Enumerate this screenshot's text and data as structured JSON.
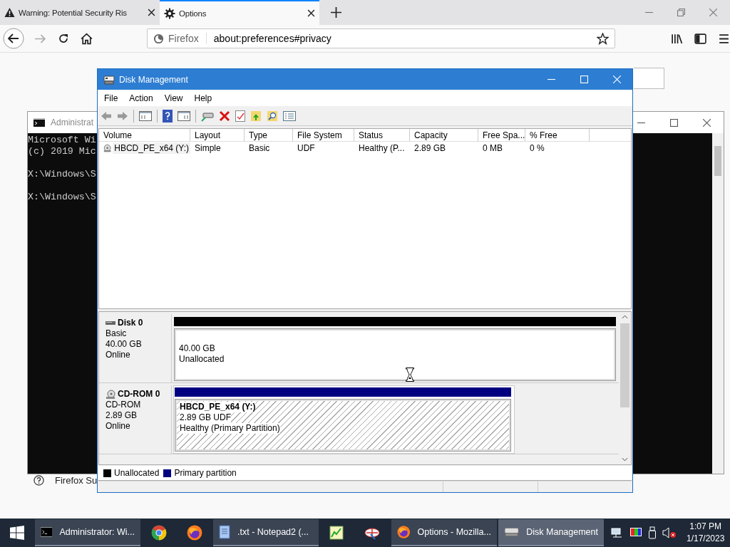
{
  "browser": {
    "tabs": [
      {
        "title": "Warning: Potential Security Ris",
        "kind": "warning",
        "selected": false
      },
      {
        "title": "Options",
        "kind": "settings",
        "selected": true
      }
    ],
    "address": {
      "identity": "Firefox",
      "url": "about:preferences#privacy"
    }
  },
  "page": {
    "support_link": "Firefox Su"
  },
  "console": {
    "title": "Administrat",
    "blocks": [
      [
        "Microsoft Wi",
        "(c) 2019 Mic"
      ],
      [
        "X:\\Windows\\S"
      ],
      [
        "X:\\Windows\\S"
      ]
    ]
  },
  "disk_management": {
    "title": "Disk Management",
    "menu": [
      "File",
      "Action",
      "View",
      "Help"
    ],
    "columns": [
      "Volume",
      "Layout",
      "Type",
      "File System",
      "Status",
      "Capacity",
      "Free Spa...",
      "% Free"
    ],
    "volumes": [
      {
        "cells": [
          "HBCD_PE_x64 (Y:)",
          "Simple",
          "Basic",
          "UDF",
          "Healthy (P...",
          "2.89 GB",
          "0 MB",
          "0 %"
        ],
        "selected": true
      }
    ],
    "disks": [
      {
        "kind": "disk",
        "name": "Disk 0",
        "type": "Basic",
        "size": "40.00 GB",
        "status": "Online",
        "partitions": [
          {
            "kind": "unallocated",
            "color": "#000000",
            "lines": [
              "40.00 GB",
              "Unallocated"
            ]
          }
        ]
      },
      {
        "kind": "cdrom",
        "name": "CD-ROM 0",
        "type": "CD-ROM",
        "size": "2.89 GB",
        "status": "Online",
        "partitions": [
          {
            "kind": "primary",
            "color": "#000080",
            "title": "HBCD_PE_x64  (Y:)",
            "lines": [
              "2.89 GB UDF",
              "Healthy (Primary Partition)"
            ]
          }
        ]
      }
    ],
    "legend": [
      {
        "label": "Unallocated",
        "color": "#000000"
      },
      {
        "label": "Primary partition",
        "color": "#000080"
      }
    ]
  },
  "taskbar": {
    "items": [
      {
        "kind": "terminal",
        "label": "Administrator: Wi...",
        "selected": false
      },
      {
        "kind": "chrome",
        "selected": false
      },
      {
        "kind": "firefox",
        "selected": false
      },
      {
        "kind": "notepad",
        "label": ".txt - Notepad2 (...",
        "selected": false
      },
      {
        "kind": "chart",
        "selected": false
      },
      {
        "kind": "pinwheel",
        "selected": false
      },
      {
        "kind": "firefox",
        "label": "Options - Mozilla...",
        "selected": false
      },
      {
        "kind": "drive",
        "label": "Disk Management",
        "selected": true
      }
    ],
    "clock": {
      "time": "1:07 PM",
      "date": "1/17/2023"
    }
  }
}
